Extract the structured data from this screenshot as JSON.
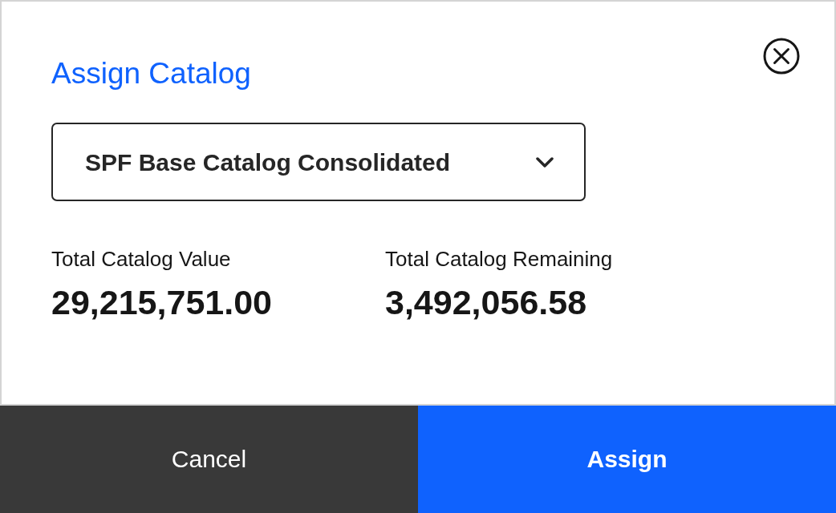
{
  "dialog": {
    "title": "Assign Catalog",
    "catalog_select": {
      "value": "SPF Base Catalog Consolidated"
    },
    "stats": [
      {
        "label": "Total Catalog Value",
        "value": "29,215,751.00"
      },
      {
        "label": "Total Catalog Remaining",
        "value": "3,492,056.58"
      }
    ],
    "buttons": [
      {
        "label": "Cancel",
        "kind": "secondary"
      },
      {
        "label": "Assign",
        "kind": "primary"
      }
    ]
  }
}
